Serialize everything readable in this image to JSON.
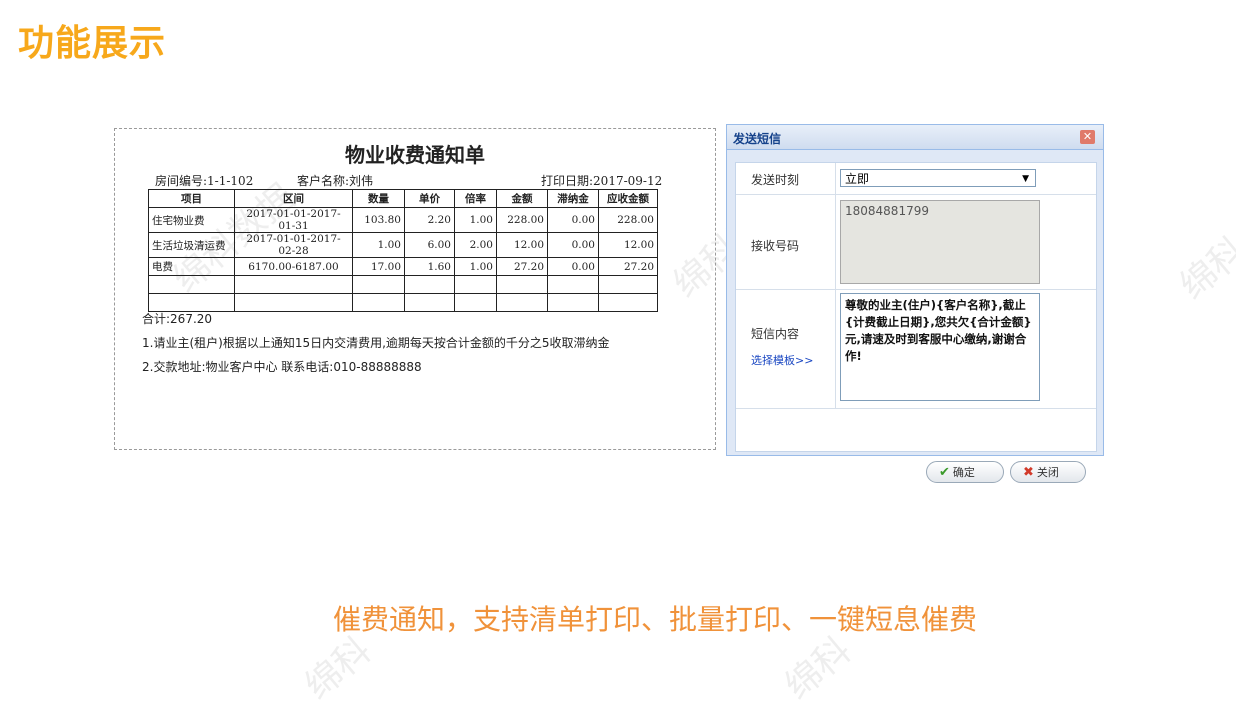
{
  "page": {
    "title": "功能展示",
    "caption": "催费通知，支持清单打印、批量打印、一键短息催费",
    "accent_color": "#f7a81b",
    "caption_color": "#f0923a"
  },
  "watermarks": [
    "绵科数据",
    "绵科数据",
    "绵科数据",
    "绵科",
    "绵科",
    "绵科"
  ],
  "notice": {
    "title": "物业收费通知单",
    "room_label": "房间编号:1-1-102",
    "customer_label": "客户名称:刘伟",
    "print_date_label": "打印日期:2017-09-12",
    "columns": [
      "项目",
      "区间",
      "数量",
      "单价",
      "倍率",
      "金额",
      "滞纳金",
      "应收金额"
    ],
    "rows": [
      [
        "住宅物业费",
        "2017-01-01-2017-01-31",
        "103.80",
        "2.20",
        "1.00",
        "228.00",
        "0.00",
        "228.00"
      ],
      [
        "生活垃圾清运费",
        "2017-01-01-2017-02-28",
        "1.00",
        "6.00",
        "2.00",
        "12.00",
        "0.00",
        "12.00"
      ],
      [
        "电费",
        "6170.00-6187.00",
        "17.00",
        "1.60",
        "1.00",
        "27.20",
        "0.00",
        "27.20"
      ],
      [
        "",
        "",
        "",
        "",
        "",
        "",
        "",
        ""
      ],
      [
        "",
        "",
        "",
        "",
        "",
        "",
        "",
        ""
      ]
    ],
    "total": "合计:267.20",
    "note1": "1.请业主(租户)根据以上通知15日内交清费用,逾期每天按合计金额的千分之5收取滞纳金",
    "note2": "2.交款地址:物业客户中心 联系电话:010-88888888"
  },
  "sms": {
    "title": "发送短信",
    "send_time_label": "发送时刻",
    "send_time_value": "立即",
    "recipient_label": "接收号码",
    "recipient_value": "18084881799",
    "content_label": "短信内容",
    "template_link": "选择模板>>",
    "content_value": "尊敬的业主(住户){客户名称},截止{计费截止日期},您共欠{合计金额}元,请速及时到客服中心缴纳,谢谢合作!",
    "confirm_label": "确定",
    "close_label": "关闭"
  }
}
